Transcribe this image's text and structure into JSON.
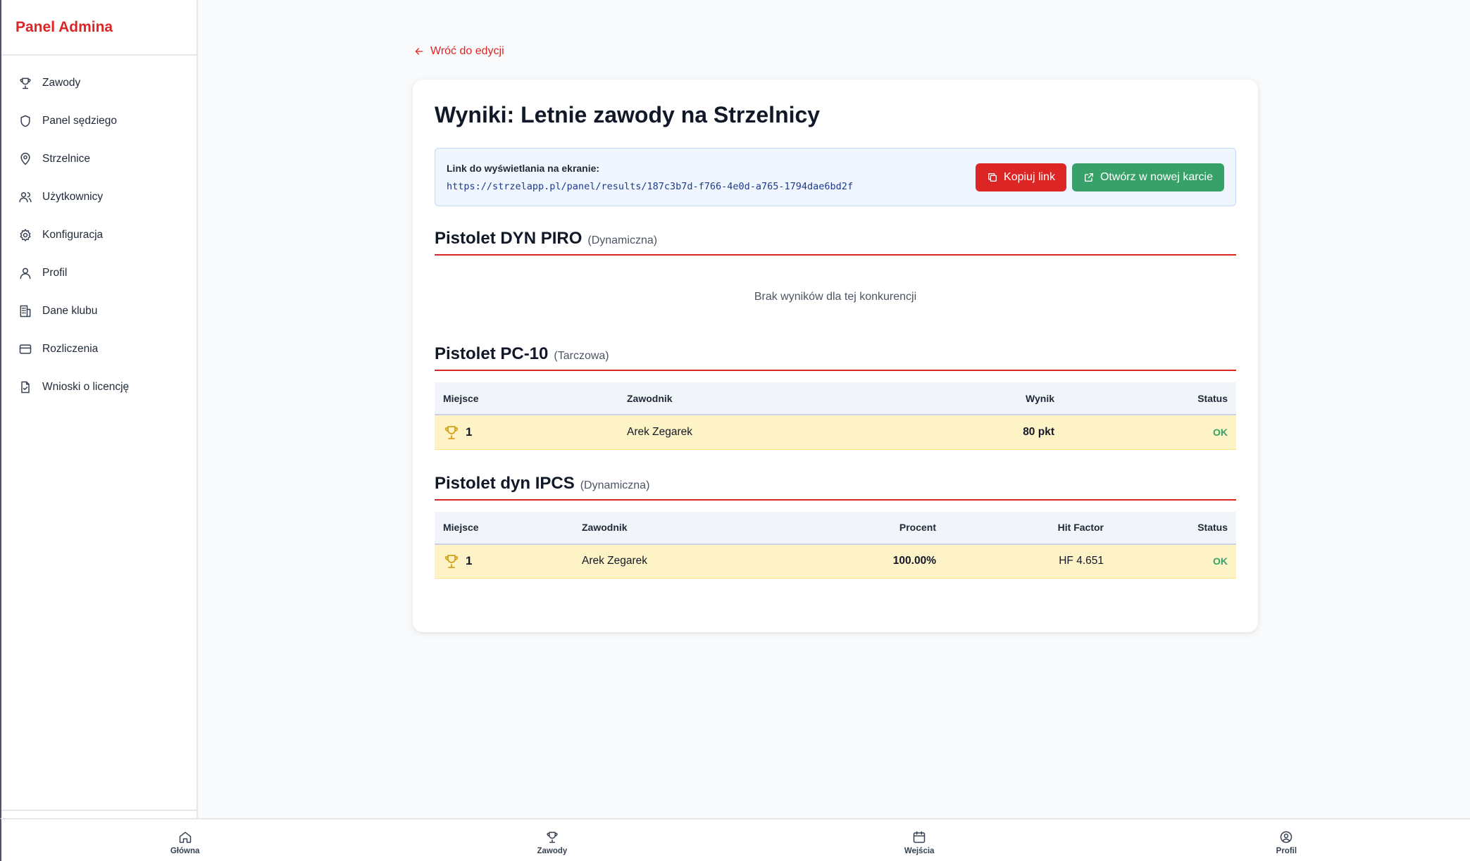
{
  "sidebar": {
    "brand": "Panel Admina",
    "items": [
      {
        "label": "Zawody",
        "icon": "trophy-icon"
      },
      {
        "label": "Panel sędziego",
        "icon": "shield-icon"
      },
      {
        "label": "Strzelnice",
        "icon": "map-pin-icon"
      },
      {
        "label": "Użytkownicy",
        "icon": "users-icon"
      },
      {
        "label": "Konfiguracja",
        "icon": "gear-icon"
      },
      {
        "label": "Profil",
        "icon": "user-icon"
      },
      {
        "label": "Dane klubu",
        "icon": "building-icon"
      },
      {
        "label": "Rozliczenia",
        "icon": "credit-card-icon"
      },
      {
        "label": "Wnioski o licencję",
        "icon": "file-check-icon"
      }
    ]
  },
  "back_link": "Wróć do edycji",
  "page_title": "Wyniki: Letnie zawody na Strzelnicy",
  "link_box": {
    "label": "Link do wyświetlania na ekranie:",
    "url": "https://strzelapp.pl/panel/results/187c3b7d-f766-4e0d-a765-1794dae6bd2f",
    "copy_label": "Kopiuj link",
    "open_label": "Otwórz w nowej karcie"
  },
  "sections": [
    {
      "title": "Pistolet DYN PIRO",
      "type": "(Dynamiczna)",
      "empty_text": "Brak wyników dla tej konkurencji"
    },
    {
      "title": "Pistolet PC-10",
      "type": "(Tarczowa)",
      "headers": {
        "place": "Miejsce",
        "player": "Zawodnik",
        "score": "Wynik",
        "status": "Status"
      },
      "rows": [
        {
          "place": "1",
          "player": "Arek Zegarek",
          "score": "80 pkt",
          "status": "OK"
        }
      ]
    },
    {
      "title": "Pistolet dyn IPCS",
      "type": "(Dynamiczna)",
      "headers": {
        "place": "Miejsce",
        "player": "Zawodnik",
        "percent": "Procent",
        "hf": "Hit Factor",
        "status": "Status"
      },
      "rows": [
        {
          "place": "1",
          "player": "Arek Zegarek",
          "percent": "100.00%",
          "hf": "HF 4.651",
          "status": "OK"
        }
      ]
    }
  ],
  "bottom_nav": [
    {
      "label": "Główna",
      "icon": "home-icon"
    },
    {
      "label": "Zawody",
      "icon": "trophy-icon"
    },
    {
      "label": "Wejścia",
      "icon": "calendar-icon"
    },
    {
      "label": "Profil",
      "icon": "user-circle-icon"
    }
  ],
  "colors": {
    "accent": "#dc2626",
    "success": "#38a169",
    "highlight_row": "#fef3c7"
  }
}
